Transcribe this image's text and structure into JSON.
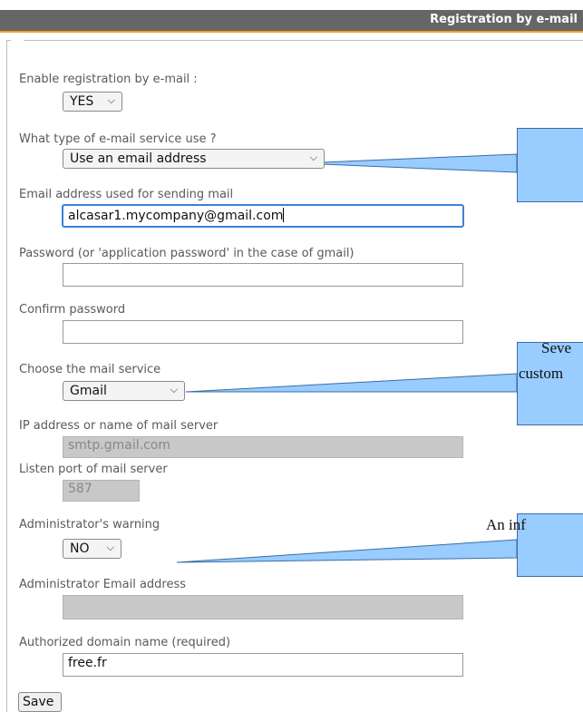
{
  "header": {
    "title": "Registration by e-mail"
  },
  "form": {
    "enable_label": "Enable registration by e-mail :",
    "enable_value": "YES",
    "service_type_label": "What type of e-mail service use ?",
    "service_type_value": "Use an email address",
    "sender_email_label": "Email address used for sending mail",
    "sender_email_value": "alcasar1.mycompany@gmail.com",
    "password_label": "Password (or 'application password' in the case of gmail)",
    "password_value": "",
    "confirm_label": "Confirm password",
    "confirm_value": "",
    "mail_service_label": "Choose the mail service",
    "mail_service_value": "Gmail",
    "server_label": "IP address or name of mail server",
    "server_value": "smtp.gmail.com",
    "port_label": "Listen port of mail server",
    "port_value": "587",
    "admin_warning_label": "Administrator's warning",
    "admin_warning_value": "NO",
    "admin_email_label": "Administrator Email address",
    "admin_email_value": "",
    "domain_label": "Authorized domain name (required)",
    "domain_value": "free.fr",
    "save_label": "Save"
  },
  "callouts": {
    "c2": "Seve",
    "c2b": "custom",
    "c3": "An inf"
  },
  "colors": {
    "header_bg": "#666666",
    "header_accent": "#f0a020",
    "callout_fill": "#99ccff",
    "focus_border": "#3b82d6"
  }
}
